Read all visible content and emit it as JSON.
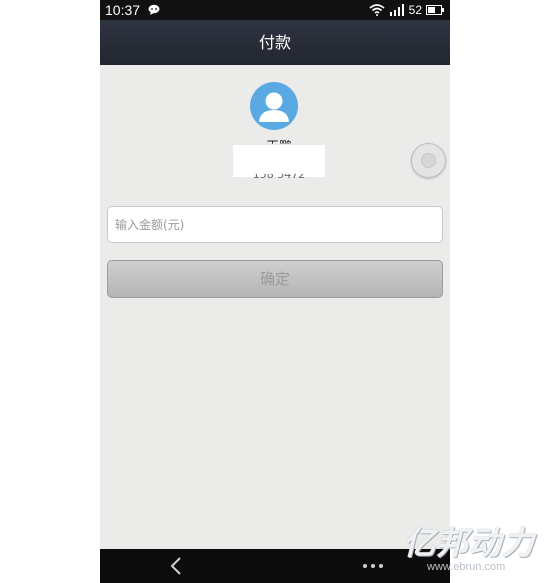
{
  "status_bar": {
    "time": "10:37",
    "battery_level": "52",
    "icons": [
      "chat-bubble-icon",
      "wifi-icon",
      "signal-icon",
      "battery-icon"
    ]
  },
  "header": {
    "title": "付款"
  },
  "payee": {
    "name": "王鹏 ",
    "account": "158 5472"
  },
  "form": {
    "amount_placeholder": "输入金额(元)",
    "amount_value": "",
    "confirm_label": "确定"
  },
  "nav": {
    "icons": [
      "back-chevron-icon",
      "more-dots-icon"
    ]
  },
  "watermark": {
    "text": "亿邦动力",
    "url": "www.ebrun.com"
  },
  "colors": {
    "title_bar": "#262a34",
    "background": "#ebebea",
    "avatar": "#5aa9e2",
    "button": "#c2c2c2"
  }
}
